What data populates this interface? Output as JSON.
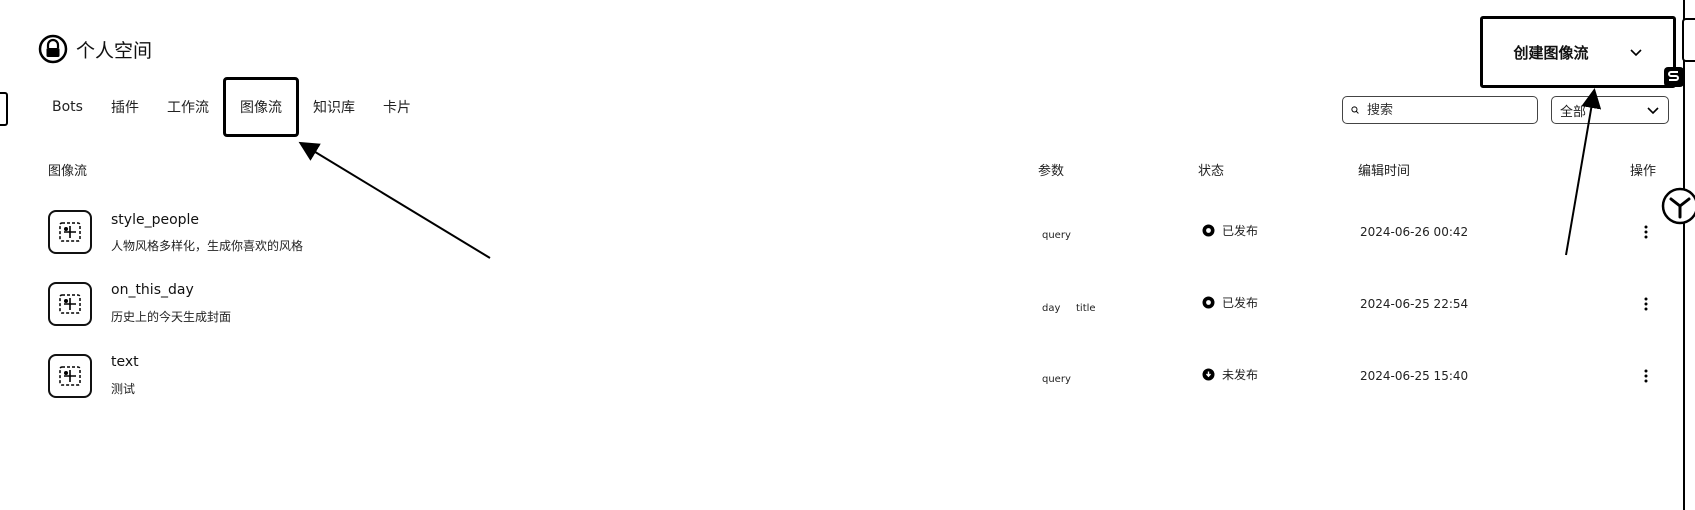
{
  "header": {
    "workspace_title": "个人空间",
    "create_button": "创建图像流"
  },
  "tabs": [
    {
      "label": "Bots"
    },
    {
      "label": "插件"
    },
    {
      "label": "工作流"
    },
    {
      "label": "图像流",
      "active": true
    },
    {
      "label": "知识库"
    },
    {
      "label": "卡片"
    }
  ],
  "search": {
    "placeholder": "搜索"
  },
  "filter": {
    "selected": "全部"
  },
  "table": {
    "headers": {
      "name": "图像流",
      "params": "参数",
      "status": "状态",
      "edited": "编辑时间",
      "actions": "操作"
    },
    "rows": [
      {
        "name": "style_people",
        "desc": "人物风格多样化，生成你喜欢的风格",
        "params": [
          "query"
        ],
        "status": "已发布",
        "edited": "2024-06-26 00:42"
      },
      {
        "name": "on_this_day",
        "desc": "历史上的今天生成封面",
        "params": [
          "day",
          "title"
        ],
        "status": "已发布",
        "edited": "2024-06-25 22:54"
      },
      {
        "name": "text",
        "desc": "测试",
        "params": [
          "query"
        ],
        "status": "未发布",
        "edited": "2024-06-25 15:40"
      }
    ]
  },
  "icons": {
    "workspace": "lock-icon",
    "row": "image-flow-icon",
    "search": "search-icon",
    "chevron": "chevron-down-icon",
    "more": "more-vertical-icon"
  },
  "colors": {
    "ink": "#000000",
    "background": "#ffffff"
  }
}
